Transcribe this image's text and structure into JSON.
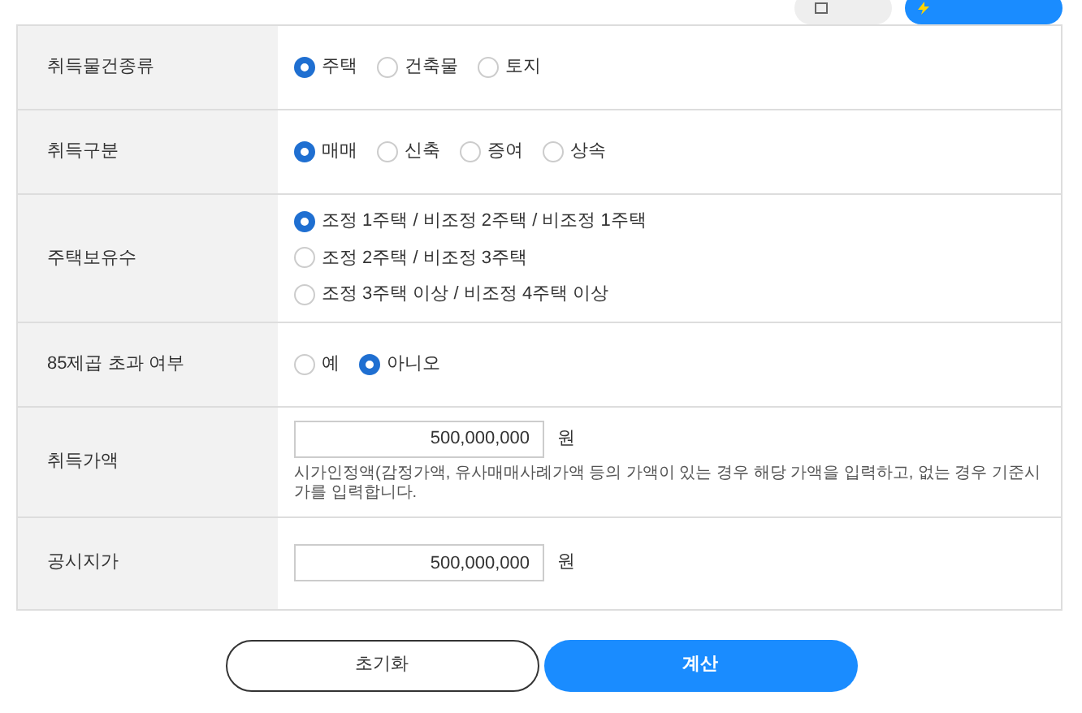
{
  "rows": [
    {
      "label": "취득물건종류",
      "kind": "radio",
      "options": [
        {
          "label": "주택",
          "selected": true
        },
        {
          "label": "건축물",
          "selected": false
        },
        {
          "label": "토지",
          "selected": false
        }
      ]
    },
    {
      "label": "취득구분",
      "kind": "radio",
      "options": [
        {
          "label": "매매",
          "selected": true
        },
        {
          "label": "신축",
          "selected": false
        },
        {
          "label": "증여",
          "selected": false
        },
        {
          "label": "상속",
          "selected": false
        }
      ]
    },
    {
      "label": "주택보유수",
      "kind": "radio",
      "options": [
        {
          "label": "조정 1주택 / 비조정 2주택 / 비조정 1주택",
          "selected": true
        },
        {
          "label": "조정 2주택 / 비조정 3주택",
          "selected": false
        },
        {
          "label": "조정 3주택 이상 / 비조정 4주택 이상",
          "selected": false
        }
      ]
    },
    {
      "label": "85제곱 초과 여부",
      "kind": "radio",
      "options": [
        {
          "label": "예",
          "selected": false
        },
        {
          "label": "아니오",
          "selected": true
        }
      ]
    },
    {
      "label": "취득가액",
      "kind": "amount",
      "value": "500,000,000",
      "unit": "원",
      "hint": "시가인정액(감정가액, 유사매매사례가액 등의 가액이 있는 경우 해당 가액을 입력하고, 없는 경우 기준시가를 입력합니다."
    },
    {
      "label": "공시지가",
      "kind": "amount",
      "value": "500,000,000",
      "unit": "원"
    }
  ],
  "buttons": [
    {
      "label": "초기화",
      "kind": "secondary"
    },
    {
      "label": "계산",
      "kind": "primary"
    }
  ]
}
